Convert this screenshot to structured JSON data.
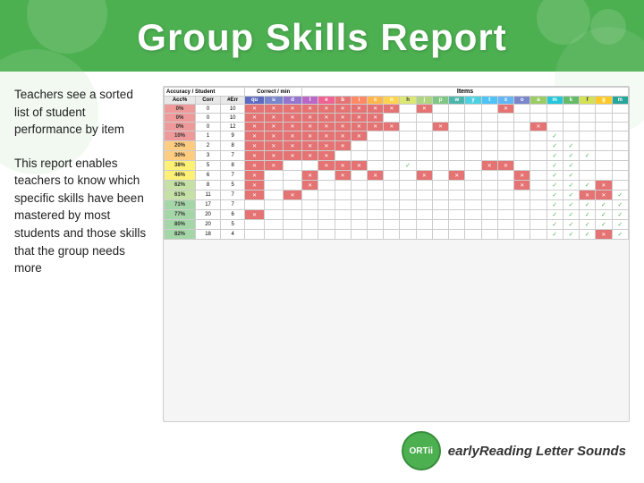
{
  "header": {
    "title": "Group Skills Report"
  },
  "text_left": {
    "block1": "Teachers see a sorted list of student performance by item",
    "block2": "This report enables teachers to know which specific skills have been mastered by most students and those skills that the group needs more"
  },
  "footer": {
    "product_name": "earlyReading Letter Sounds",
    "logo_text": "ORTii"
  },
  "table": {
    "col_labels": [
      "qu",
      "u",
      "d",
      "l",
      "e",
      "b",
      "i",
      "c",
      "n",
      "h",
      "j",
      "p",
      "w",
      "y",
      "t",
      "x",
      "o",
      "a",
      "m",
      "k",
      "f",
      "g",
      "m"
    ],
    "rows": [
      {
        "pct": "0%",
        "corr": "0",
        "err": "10",
        "cells": [
          "x",
          "x",
          "x",
          "x",
          "x",
          "x",
          "x",
          "x",
          "x",
          "",
          "x",
          "",
          "",
          "",
          "",
          "x",
          "",
          "",
          "",
          "",
          "",
          "",
          ""
        ]
      },
      {
        "pct": "0%",
        "corr": "0",
        "err": "10",
        "cells": [
          "x",
          "x",
          "x",
          "x",
          "x",
          "x",
          "x",
          "x",
          "",
          "",
          "",
          "",
          "",
          "",
          "",
          "",
          "",
          "",
          "",
          "",
          "",
          "",
          ""
        ]
      },
      {
        "pct": "0%",
        "corr": "0",
        "err": "12",
        "cells": [
          "x",
          "x",
          "x",
          "x",
          "x",
          "x",
          "x",
          "x",
          "x",
          "",
          "",
          "x",
          "",
          "",
          "",
          "",
          "",
          "x",
          "",
          "",
          "",
          "",
          ""
        ]
      },
      {
        "pct": "10%",
        "corr": "1",
        "err": "9",
        "cells": [
          "x",
          "x",
          "x",
          "x",
          "x",
          "x",
          "x",
          "",
          "",
          "",
          "",
          "",
          "",
          "",
          "",
          "",
          "",
          "",
          "✓",
          "",
          "",
          "",
          ""
        ]
      },
      {
        "pct": "20%",
        "corr": "2",
        "err": "8",
        "cells": [
          "x",
          "x",
          "x",
          "x",
          "x",
          "x",
          "",
          "",
          "",
          "",
          "",
          "",
          "",
          "",
          "",
          "",
          "",
          "",
          "✓",
          "✓",
          "",
          "",
          ""
        ]
      },
      {
        "pct": "30%",
        "corr": "3",
        "err": "7",
        "cells": [
          "x",
          "x",
          "x",
          "x",
          "x",
          "",
          "",
          "",
          "",
          "",
          "",
          "",
          "",
          "",
          "",
          "",
          "",
          "",
          "✓",
          "✓",
          "✓",
          "",
          ""
        ]
      },
      {
        "pct": "38%",
        "corr": "5",
        "err": "8",
        "cells": [
          "x",
          "x",
          "",
          "",
          "x",
          "x",
          "x",
          "",
          "",
          "✓",
          "",
          "",
          "",
          "",
          "x",
          "x",
          "",
          "",
          "✓",
          "✓",
          "",
          "",
          ""
        ]
      },
      {
        "pct": "46%",
        "corr": "6",
        "err": "7",
        "cells": [
          "x",
          "",
          "",
          "x",
          "",
          "x",
          "",
          "x",
          "",
          "",
          "x",
          "",
          "x",
          "",
          "",
          "",
          "x",
          "",
          "✓",
          "✓",
          "",
          "",
          ""
        ]
      },
      {
        "pct": "62%",
        "corr": "8",
        "err": "5",
        "cells": [
          "x",
          "",
          "",
          "x",
          "",
          "",
          "",
          "",
          "",
          "",
          "",
          "",
          "",
          "",
          "",
          "",
          "x",
          "",
          "✓",
          "✓",
          "✓",
          "x",
          ""
        ]
      },
      {
        "pct": "61%",
        "corr": "11",
        "err": "7",
        "cells": [
          "x",
          "",
          "x",
          "",
          "",
          "",
          "",
          "",
          "",
          "",
          "",
          "",
          "",
          "",
          "",
          "",
          "",
          "",
          "✓",
          "✓",
          "x",
          "x",
          "✓"
        ]
      },
      {
        "pct": "71%",
        "corr": "17",
        "err": "7",
        "cells": [
          "",
          "",
          "",
          "",
          "",
          "",
          "",
          "",
          "",
          "",
          "",
          "",
          "",
          "",
          "",
          "",
          "",
          "",
          "✓",
          "✓",
          "✓",
          "✓",
          "✓"
        ]
      },
      {
        "pct": "77%",
        "corr": "20",
        "err": "6",
        "cells": [
          "x",
          "",
          "",
          "",
          "",
          "",
          "",
          "",
          "",
          "",
          "",
          "",
          "",
          "",
          "",
          "",
          "",
          "",
          "✓",
          "✓",
          "✓",
          "✓",
          "✓"
        ]
      },
      {
        "pct": "80%",
        "corr": "20",
        "err": "5",
        "cells": [
          "",
          "",
          "",
          "",
          "",
          "",
          "",
          "",
          "",
          "",
          "",
          "",
          "",
          "",
          "",
          "",
          "",
          "",
          "✓",
          "✓",
          "✓",
          "✓",
          "✓"
        ]
      },
      {
        "pct": "82%",
        "corr": "18",
        "err": "4",
        "cells": [
          "",
          "",
          "",
          "",
          "",
          "",
          "",
          "",
          "",
          "",
          "",
          "",
          "",
          "",
          "",
          "",
          "",
          "",
          "✓",
          "✓",
          "✓",
          "x",
          "✓"
        ]
      }
    ]
  },
  "colors": {
    "green": "#4caf50",
    "header_green": "#4caf50",
    "cell_x": "#e57373",
    "cell_check": "#4caf50",
    "pct_bg_low": "#ef9a9a",
    "pct_bg_mid": "#ffcc80",
    "pct_bg_high": "#a5d6a7"
  }
}
